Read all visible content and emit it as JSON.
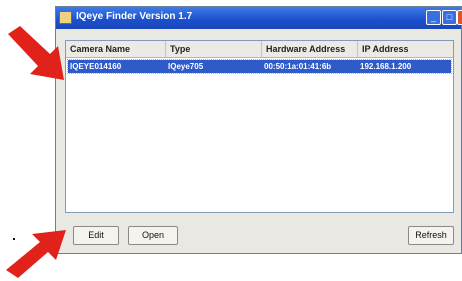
{
  "window": {
    "title": "IQeye  Finder Version 1.7"
  },
  "columns": [
    "Camera Name",
    "Type",
    "Hardware Address",
    "IP Address"
  ],
  "rows": [
    {
      "camera_name": "IQEYE014160",
      "type": "IQeye705",
      "hardware_address": "00:50:1a:01:41:6b",
      "ip_address": "192.168.1.200"
    }
  ],
  "buttons": {
    "edit": "Edit",
    "open": "Open",
    "refresh": "Refresh"
  },
  "colors": {
    "title_bar": "#1b4fcb",
    "selection": "#2f5bc8",
    "arrow": "#e0221b"
  }
}
